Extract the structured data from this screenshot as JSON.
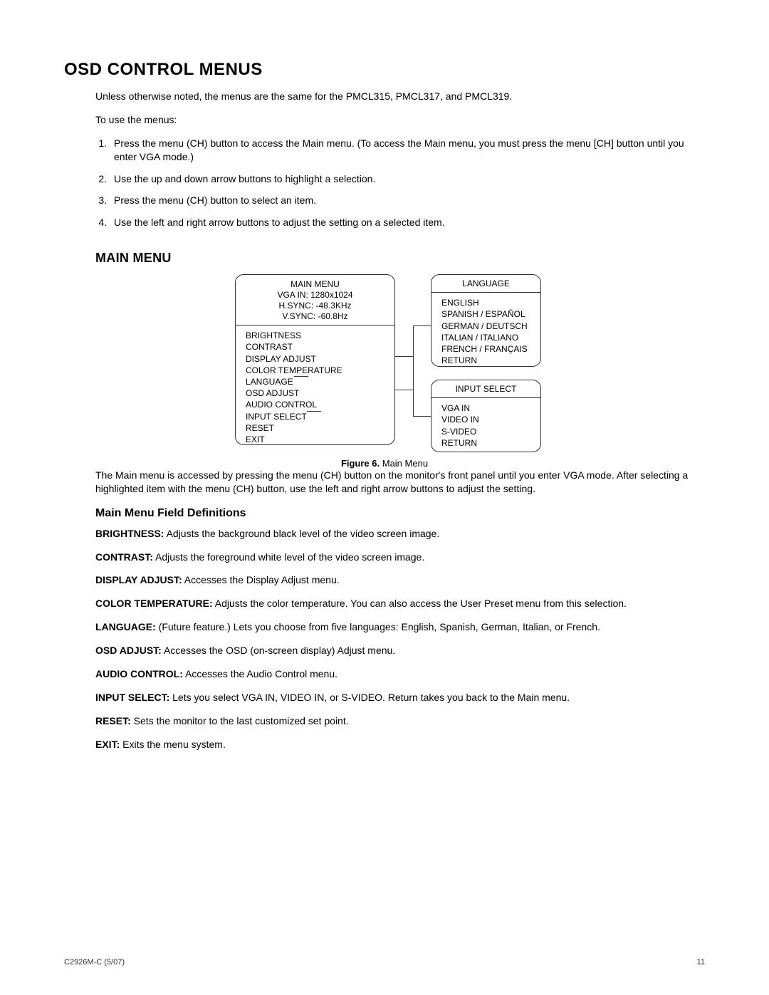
{
  "title": "OSD CONTROL MENUS",
  "intro1": "Unless otherwise noted, the menus are the same for the PMCL315, PMCL317, and PMCL319.",
  "intro2": "To use the menus:",
  "steps": [
    "Press the menu (CH) button to access the Main menu. (To access the Main menu, you must press the menu [CH] button until you enter VGA mode.)",
    "Use the up and down arrow buttons to highlight a selection.",
    "Press the menu (CH) button to select an item.",
    "Use the left and right arrow buttons to adjust the setting on a selected item."
  ],
  "section_main": "MAIN MENU",
  "main_box": {
    "title": "MAIN MENU",
    "vga": "VGA IN: 1280x1024",
    "hsync": "H.SYNC: -48.3KHz",
    "vsync": "V.SYNC: -60.8Hz",
    "items": [
      "BRIGHTNESS",
      "CONTRAST",
      "DISPLAY ADJUST",
      "COLOR TEMPERATURE",
      "LANGUAGE",
      "OSD ADJUST",
      "AUDIO CONTROL",
      "INPUT SELECT",
      "RESET",
      "EXIT"
    ]
  },
  "lang_box": {
    "title": "LANGUAGE",
    "items": [
      "ENGLISH",
      "SPANISH / ESPAÑOL",
      "GERMAN / DEUTSCH",
      "ITALIAN / ITALIANO",
      "FRENCH / FRANÇAIS",
      "RETURN"
    ]
  },
  "input_box": {
    "title": "INPUT SELECT",
    "items": [
      "VGA IN",
      "VIDEO IN",
      "S-VIDEO",
      "RETURN"
    ]
  },
  "figure_label_bold": "Figure 6.",
  "figure_label_rest": " Main Menu",
  "after_figure": "The Main menu is accessed by pressing the menu (CH) button on the monitor's front panel until you enter VGA mode. After selecting a highlighted item with the menu (CH) button, use the left and right arrow buttons to adjust the setting.",
  "defs_heading": "Main Menu Field Definitions",
  "defs": [
    {
      "term": "BRIGHTNESS:",
      "text": " Adjusts the background black level of the video screen image."
    },
    {
      "term": "CONTRAST:",
      "text": " Adjusts the foreground white level of the video screen image."
    },
    {
      "term": "DISPLAY ADJUST:",
      "text": " Accesses the Display Adjust menu."
    },
    {
      "term": "COLOR TEMPERATURE:",
      "text": " Adjusts the color temperature. You can also access the User Preset menu from this selection."
    },
    {
      "term": "LANGUAGE:",
      "text": " (Future feature.) Lets you choose from five languages: English, Spanish, German, Italian, or French."
    },
    {
      "term": "OSD ADJUST:",
      "text": " Accesses the OSD (on-screen display) Adjust menu."
    },
    {
      "term": "AUDIO CONTROL:",
      "text": " Accesses the Audio Control menu."
    },
    {
      "term": "INPUT SELECT:",
      "text": " Lets you select VGA IN, VIDEO IN, or S-VIDEO. Return takes you back to the Main menu."
    },
    {
      "term": "RESET:",
      "text": " Sets the monitor to the last customized set point."
    },
    {
      "term": "EXIT:",
      "text": " Exits the menu system."
    }
  ],
  "footer_left": "C2926M-C (5/07)",
  "footer_right": "11"
}
